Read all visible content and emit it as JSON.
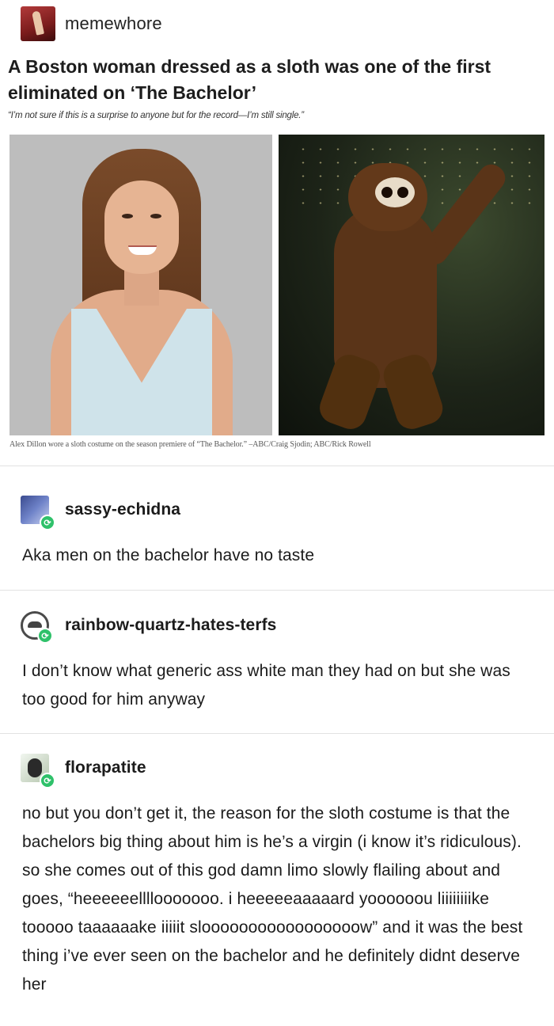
{
  "original_post": {
    "username": "memewhore",
    "headline": "A Boston woman dressed as a sloth was one of the first eliminated on ‘The Bachelor’",
    "subhead": "“I’m not sure if this is a surprise to anyone but for the record—I’m still single.”",
    "photo_caption": "Alex Dillon wore a sloth costume on the season premiere of “The Bachelor.” –ABC/Craig Sjodin; ABC/Rick Rowell",
    "images": [
      {
        "icon": "woman-portrait-photo"
      },
      {
        "icon": "sloth-costume-photo"
      }
    ]
  },
  "reblogs": [
    {
      "username": "sassy-echidna",
      "text": "Aka men on the bachelor have no taste"
    },
    {
      "username": "rainbow-quartz-hates-terfs",
      "text": "I don’t know what generic ass white man they had on but she was too good for him anyway"
    },
    {
      "username": "florapatite",
      "text": "no but you don’t get it, the reason for the sloth costume is that the bachelors big thing about him is he’s a virgin (i know it’s ridiculous). so she comes out of this god damn limo slowly flailing about and goes, “heeeeeellllooooooo. i heeeeeaaaaard yoooooou liiiiiiiike tooooo taaaaaake iiiiit slooooooooooooooooow” and it was the best thing i’ve ever seen on the bachelor and he definitely didnt deserve her"
    }
  ],
  "colors": {
    "reblog_badge": "#2fc16a",
    "divider": "#e2e2e2",
    "text": "#1b1b1b"
  }
}
